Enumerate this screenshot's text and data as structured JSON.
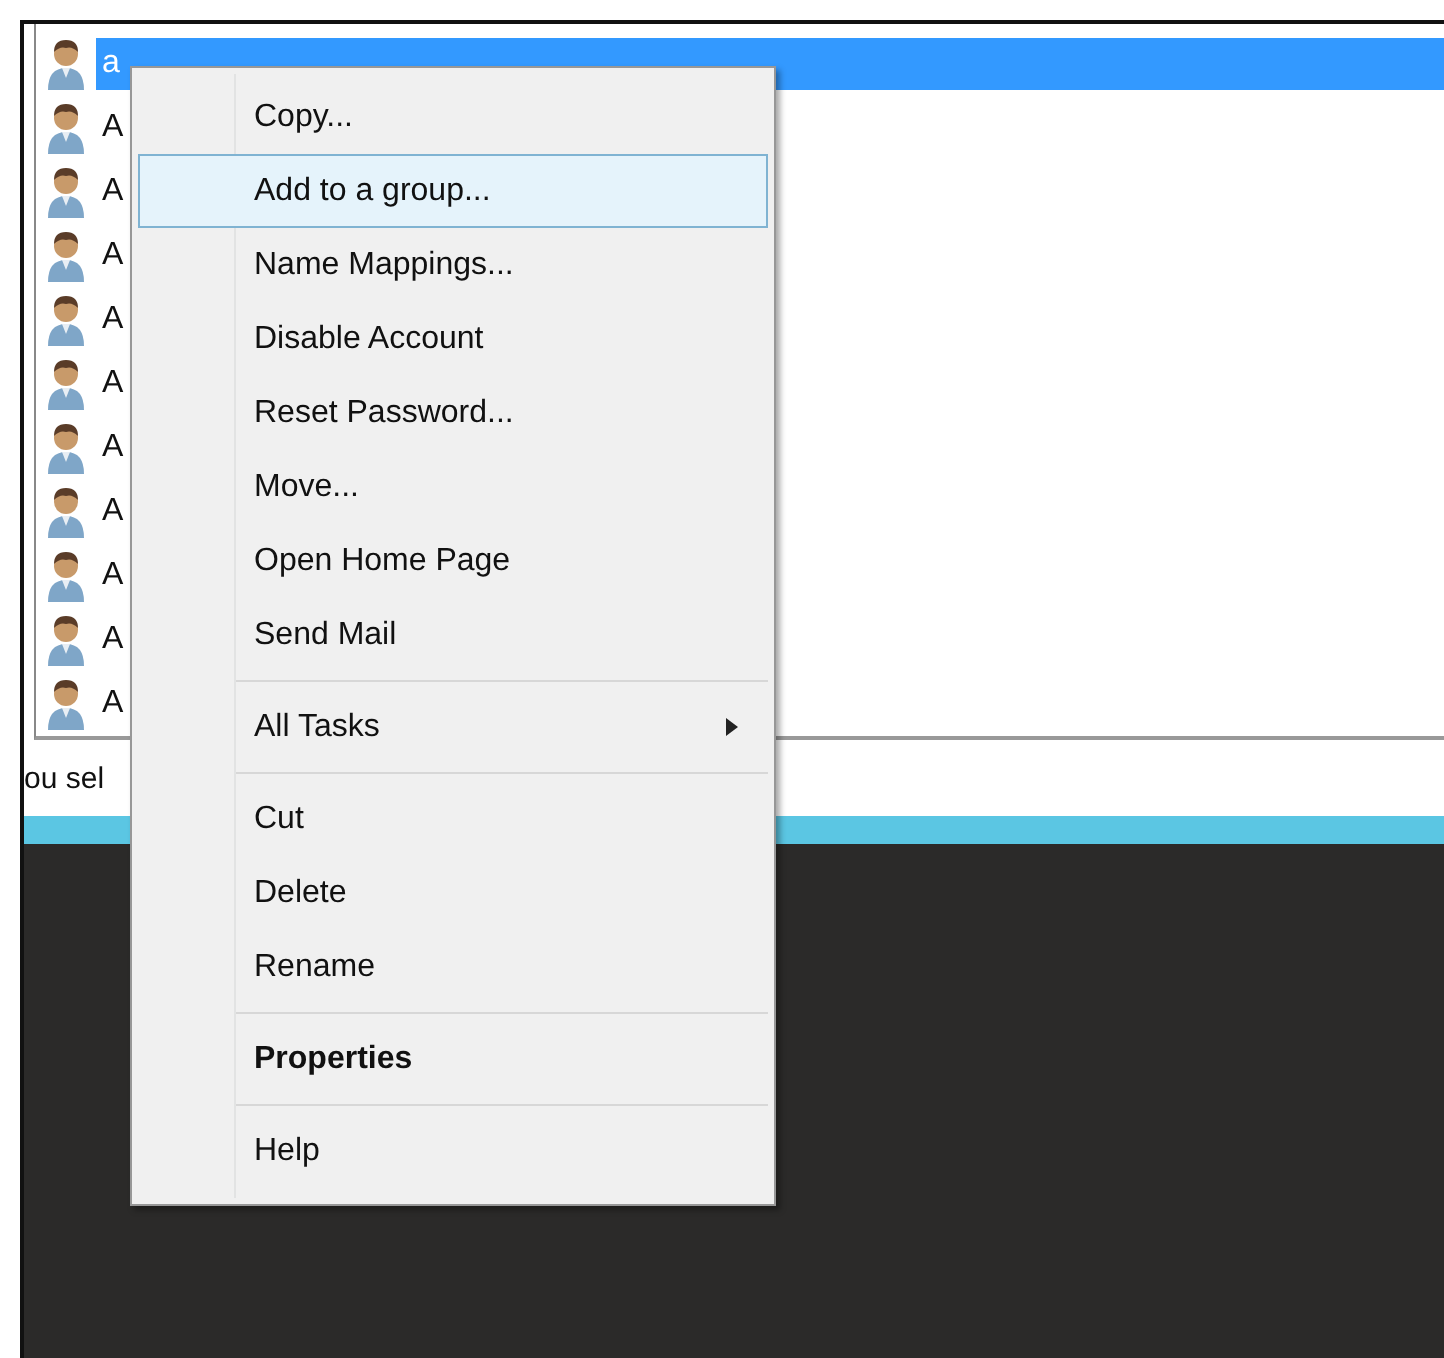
{
  "list": {
    "rows": [
      {
        "label": "a",
        "selected": true
      },
      {
        "label": "A",
        "selected": false
      },
      {
        "label": "A",
        "selected": false
      },
      {
        "label": "A",
        "selected": false
      },
      {
        "label": "A",
        "selected": false
      },
      {
        "label": "A",
        "selected": false
      },
      {
        "label": "A",
        "selected": false
      },
      {
        "label": "A",
        "selected": false
      },
      {
        "label": "A",
        "selected": false
      },
      {
        "label": "A",
        "selected": false
      },
      {
        "label": "A",
        "selected": false
      }
    ]
  },
  "status_bar": {
    "text": "ou sel"
  },
  "context_menu": {
    "items": [
      {
        "kind": "item",
        "label": "Copy...",
        "selected": false
      },
      {
        "kind": "item",
        "label": "Add to a group...",
        "selected": true
      },
      {
        "kind": "item",
        "label": "Name Mappings...",
        "selected": false
      },
      {
        "kind": "item",
        "label": "Disable Account",
        "selected": false
      },
      {
        "kind": "item",
        "label": "Reset Password...",
        "selected": false
      },
      {
        "kind": "item",
        "label": "Move...",
        "selected": false
      },
      {
        "kind": "item",
        "label": "Open Home Page",
        "selected": false
      },
      {
        "kind": "item",
        "label": "Send Mail",
        "selected": false
      },
      {
        "kind": "separator"
      },
      {
        "kind": "submenu",
        "label": "All Tasks",
        "selected": false
      },
      {
        "kind": "separator"
      },
      {
        "kind": "item",
        "label": "Cut",
        "selected": false
      },
      {
        "kind": "item",
        "label": "Delete",
        "selected": false
      },
      {
        "kind": "item",
        "label": "Rename",
        "selected": false
      },
      {
        "kind": "separator"
      },
      {
        "kind": "default",
        "label": "Properties",
        "selected": false
      },
      {
        "kind": "separator"
      },
      {
        "kind": "item",
        "label": "Help",
        "selected": false
      }
    ]
  }
}
